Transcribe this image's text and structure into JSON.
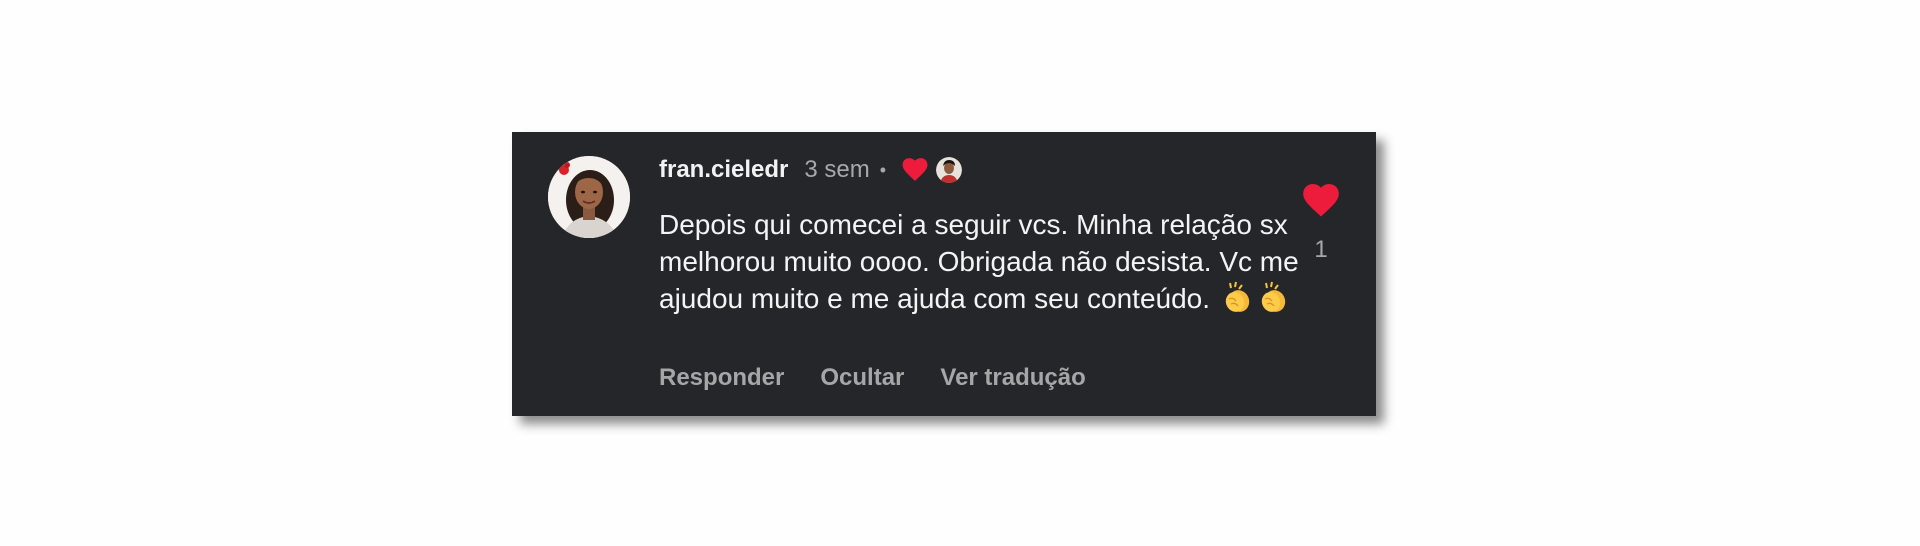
{
  "comment": {
    "username": "fran.cieledr",
    "time_ago": "3 sem",
    "separator": "•",
    "text": "Depois qui comecei a seguir vcs. Minha relação sx melhorou muito oooo. Obrigada não desista. Vc me ajudou muito e me ajuda com seu conteúdo.",
    "emoji": [
      "clapping-hands",
      "clapping-hands"
    ],
    "like_count": "1",
    "liked": true,
    "liked_by_creator": true
  },
  "actions": {
    "reply_label": "Responder",
    "hide_label": "Ocultar",
    "translate_label": "Ver tradução"
  },
  "colors": {
    "card_background": "#252629",
    "like_red": "#ee1c3c",
    "primary_text": "#f2f2f2",
    "secondary_text": "#a8a8a8"
  }
}
